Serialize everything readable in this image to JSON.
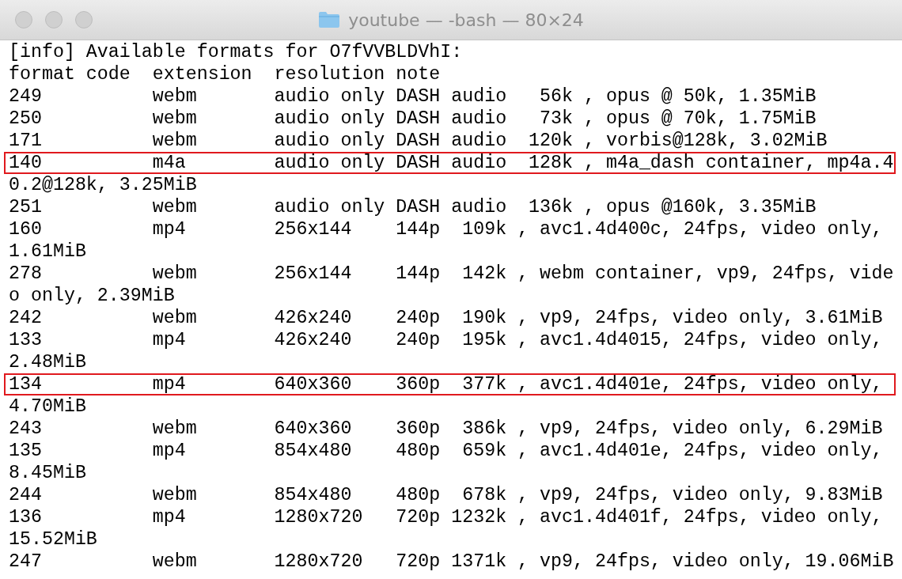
{
  "window": {
    "title": "youtube — -bash — 80×24"
  },
  "terminal": {
    "lines": [
      {
        "text": "[info] Available formats for O7fVVBLDVhI:",
        "highlighted": false
      },
      {
        "text": "format code  extension  resolution note",
        "highlighted": false
      },
      {
        "text": "249          webm       audio only DASH audio   56k , opus @ 50k, 1.35MiB",
        "highlighted": false
      },
      {
        "text": "250          webm       audio only DASH audio   73k , opus @ 70k, 1.75MiB",
        "highlighted": false
      },
      {
        "text": "171          webm       audio only DASH audio  120k , vorbis@128k, 3.02MiB",
        "highlighted": false
      },
      {
        "text": "140          m4a        audio only DASH audio  128k , m4a_dash container, mp4a.4",
        "highlighted": true
      },
      {
        "text": "0.2@128k, 3.25MiB",
        "highlighted": false
      },
      {
        "text": "251          webm       audio only DASH audio  136k , opus @160k, 3.35MiB",
        "highlighted": false
      },
      {
        "text": "160          mp4        256x144    144p  109k , avc1.4d400c, 24fps, video only,",
        "highlighted": false
      },
      {
        "text": "1.61MiB",
        "highlighted": false
      },
      {
        "text": "278          webm       256x144    144p  142k , webm container, vp9, 24fps, vide",
        "highlighted": false
      },
      {
        "text": "o only, 2.39MiB",
        "highlighted": false
      },
      {
        "text": "242          webm       426x240    240p  190k , vp9, 24fps, video only, 3.61MiB",
        "highlighted": false
      },
      {
        "text": "133          mp4        426x240    240p  195k , avc1.4d4015, 24fps, video only,",
        "highlighted": false
      },
      {
        "text": "2.48MiB",
        "highlighted": false
      },
      {
        "text": "134          mp4        640x360    360p  377k , avc1.4d401e, 24fps, video only,",
        "highlighted": true
      },
      {
        "text": "4.70MiB",
        "highlighted": false
      },
      {
        "text": "243          webm       640x360    360p  386k , vp9, 24fps, video only, 6.29MiB",
        "highlighted": false
      },
      {
        "text": "135          mp4        854x480    480p  659k , avc1.4d401e, 24fps, video only,",
        "highlighted": false
      },
      {
        "text": "8.45MiB",
        "highlighted": false
      },
      {
        "text": "244          webm       854x480    480p  678k , vp9, 24fps, video only, 9.83MiB",
        "highlighted": false
      },
      {
        "text": "136          mp4        1280x720   720p 1232k , avc1.4d401f, 24fps, video only,",
        "highlighted": false
      },
      {
        "text": "15.52MiB",
        "highlighted": false
      },
      {
        "text": "247          webm       1280x720   720p 1371k , vp9, 24fps, video only, 19.06MiB",
        "highlighted": false
      }
    ]
  }
}
